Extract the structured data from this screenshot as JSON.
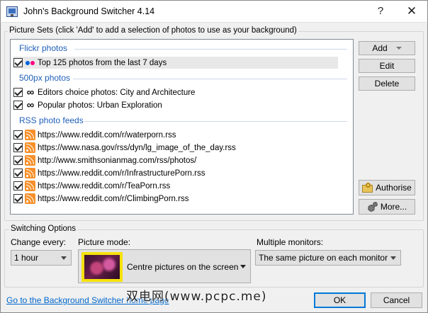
{
  "window": {
    "title": "John's Background Switcher 4.14",
    "help": "?",
    "close": "✕"
  },
  "picture_sets": {
    "group_title": "Picture Sets (click 'Add' to add a selection of photos to use as your background)",
    "categories": [
      {
        "name": "Flickr photos",
        "items": [
          {
            "label": "Top 125 photos from the last 7 days",
            "icon": "flickr-icon",
            "checked": true,
            "selected": true
          }
        ]
      },
      {
        "name": "500px photos",
        "items": [
          {
            "label": "Editors choice photos: City and Architecture",
            "icon": "infinity-icon",
            "checked": true
          },
          {
            "label": "Popular photos: Urban Exploration",
            "icon": "infinity-icon",
            "checked": true
          }
        ]
      },
      {
        "name": "RSS photo feeds",
        "items": [
          {
            "label": "https://www.reddit.com/r/waterporn.rss",
            "icon": "rss-icon",
            "checked": true
          },
          {
            "label": "https://www.nasa.gov/rss/dyn/lg_image_of_the_day.rss",
            "icon": "rss-icon",
            "checked": true
          },
          {
            "label": "http://www.smithsonianmag.com/rss/photos/",
            "icon": "rss-icon",
            "checked": true
          },
          {
            "label": "https://www.reddit.com/r/InfrastructurePorn.rss",
            "icon": "rss-icon",
            "checked": true
          },
          {
            "label": "https://www.reddit.com/r/TeaPorn.rss",
            "icon": "rss-icon",
            "checked": true
          },
          {
            "label": "https://www.reddit.com/r/ClimbingPorn.rss",
            "icon": "rss-icon",
            "checked": true
          }
        ]
      }
    ],
    "buttons": {
      "add": "Add",
      "edit": "Edit",
      "delete": "Delete",
      "authorise": "Authorise",
      "more": "More..."
    }
  },
  "switching": {
    "group_title": "Switching Options",
    "change_every_label": "Change every:",
    "change_every_value": "1 hour",
    "picture_mode_label": "Picture mode:",
    "picture_mode_value": "Centre pictures on the screen",
    "multiple_monitors_label": "Multiple monitors:",
    "multiple_monitors_value": "The same picture on each monitor"
  },
  "footer": {
    "link": "Go to the Background Switcher home page",
    "ok": "OK",
    "cancel": "Cancel",
    "watermark": "双电网(www.pcpc.me)"
  },
  "colors": {
    "category_text": "#1f5fb8",
    "link": "#0066cc",
    "accent_border": "#0078d7",
    "rss": "#f7902a",
    "flickr_blue": "#0063dc",
    "flickr_pink": "#ff0084"
  }
}
